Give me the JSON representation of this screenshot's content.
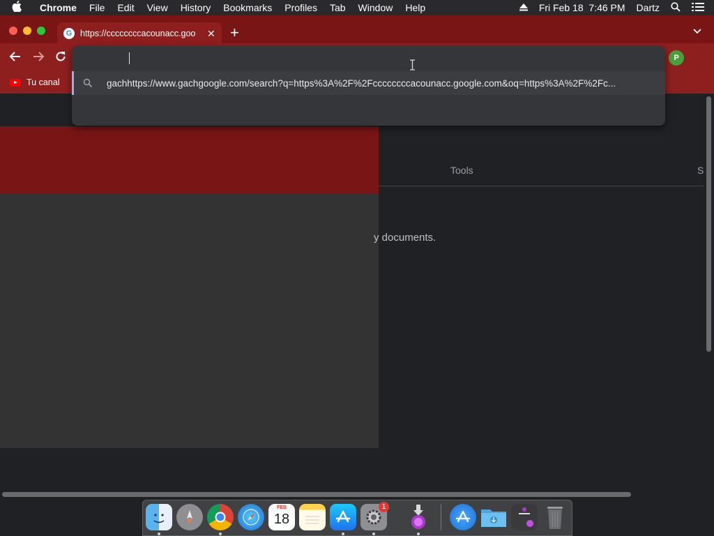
{
  "menubar": {
    "app_name": "Chrome",
    "items": [
      "File",
      "Edit",
      "View",
      "History",
      "Bookmarks",
      "Profiles",
      "Tab",
      "Window",
      "Help"
    ],
    "datetime": "Fri Feb 18  7:46 PM",
    "user": "Dartz"
  },
  "tab": {
    "title": "https://ccccccccacounacc.goo",
    "favicon_letter": "G"
  },
  "bookmarks": {
    "item_label": "Tu canal"
  },
  "omnibox": {
    "suggestion_text": "gachhttps://www.gachgoogle.com/search?q=https%3A%2F%2Fccccccccacounacc.google.com&oq=https%3A%2F%2Fc..."
  },
  "profile": {
    "initial": "P"
  },
  "page": {
    "tools_label": "Tools",
    "settings_partial": "S",
    "doc_text": "y documents."
  },
  "dock": {
    "calendar_month": "FEB",
    "calendar_day": "18",
    "badge_count": "1"
  },
  "colors": {
    "frame_red": "#7a1515",
    "toolbar_red": "#8e1f1f",
    "accent_blue": "#8ab4f8"
  }
}
